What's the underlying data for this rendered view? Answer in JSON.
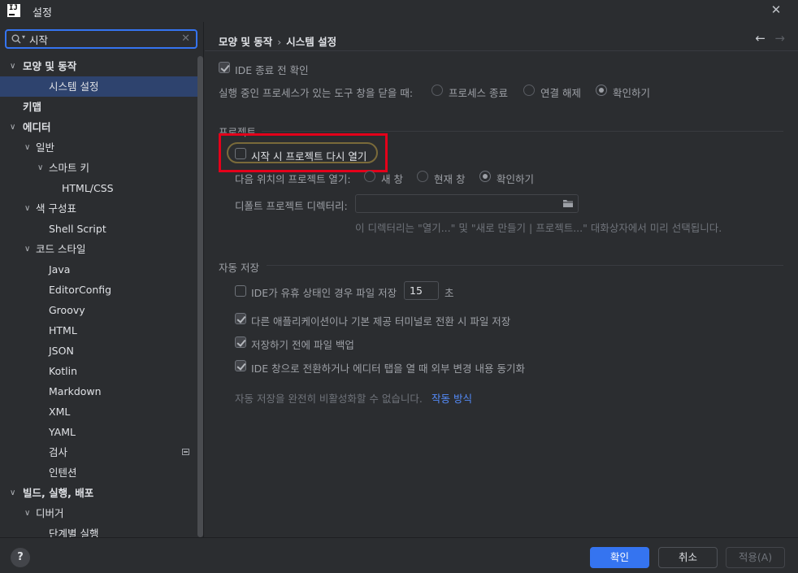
{
  "window": {
    "title": "설정",
    "logo_text": "IJ"
  },
  "search": {
    "value": "시작"
  },
  "tree": [
    {
      "label": "모양 및 동작",
      "arrow": "∨",
      "bold": true,
      "indent": 0
    },
    {
      "label": "시스템 설정",
      "arrow": "",
      "bold": false,
      "indent": 2,
      "selected": true
    },
    {
      "label": "키맵",
      "arrow": "",
      "bold": true,
      "indent": 0
    },
    {
      "label": "에디터",
      "arrow": "∨",
      "bold": true,
      "indent": 0
    },
    {
      "label": "일반",
      "arrow": "∨",
      "bold": false,
      "indent": 1
    },
    {
      "label": "스마트 키",
      "arrow": "∨",
      "bold": false,
      "indent": 2
    },
    {
      "label": "HTML/CSS",
      "arrow": "",
      "bold": false,
      "indent": 4
    },
    {
      "label": "색 구성표",
      "arrow": "∨",
      "bold": false,
      "indent": 1
    },
    {
      "label": "Shell Script",
      "arrow": "",
      "bold": false,
      "indent": 3
    },
    {
      "label": "코드 스타일",
      "arrow": "∨",
      "bold": false,
      "indent": 1
    },
    {
      "label": "Java",
      "arrow": "",
      "bold": false,
      "indent": 3
    },
    {
      "label": "EditorConfig",
      "arrow": "",
      "bold": false,
      "indent": 3
    },
    {
      "label": "Groovy",
      "arrow": "",
      "bold": false,
      "indent": 3
    },
    {
      "label": "HTML",
      "arrow": "",
      "bold": false,
      "indent": 3
    },
    {
      "label": "JSON",
      "arrow": "",
      "bold": false,
      "indent": 3
    },
    {
      "label": "Kotlin",
      "arrow": "",
      "bold": false,
      "indent": 3
    },
    {
      "label": "Markdown",
      "arrow": "",
      "bold": false,
      "indent": 3
    },
    {
      "label": "XML",
      "arrow": "",
      "bold": false,
      "indent": 3
    },
    {
      "label": "YAML",
      "arrow": "",
      "bold": false,
      "indent": 3
    },
    {
      "label": "검사",
      "arrow": "",
      "bold": false,
      "indent": 2,
      "badge": true
    },
    {
      "label": "인텐션",
      "arrow": "",
      "bold": false,
      "indent": 2
    },
    {
      "label": "빌드, 실행, 배포",
      "arrow": "∨",
      "bold": true,
      "indent": 0
    },
    {
      "label": "디버거",
      "arrow": "∨",
      "bold": false,
      "indent": 1
    },
    {
      "label": "단계별 실행",
      "arrow": "",
      "bold": false,
      "indent": 3
    }
  ],
  "breadcrumb": {
    "parent": "모양 및 동작",
    "separator": "›",
    "current": "시스템 설정"
  },
  "nav": {
    "back": "←",
    "forward": "→"
  },
  "settings": {
    "confirm_exit": {
      "label": "IDE 종료 전 확인",
      "checked": true
    },
    "close_tool_window": {
      "label": "실행 중인 프로세스가 있는 도구 창을 닫을 때:",
      "options": [
        "프로세스 종료",
        "연결 해제",
        "확인하기"
      ],
      "selected": "확인하기"
    },
    "project_section": "프로젝트",
    "reopen_projects": {
      "label": "시작 시 프로젝트 다시 열기",
      "checked": false
    },
    "open_new_project": {
      "label": "다음 위치의 프로젝트 열기:",
      "options": [
        "새 창",
        "현재 창",
        "확인하기"
      ],
      "selected": "확인하기"
    },
    "default_dir": {
      "label": "디폴트 프로젝트 디렉터리:",
      "value": ""
    },
    "default_dir_hint": "이 디렉터리는 \"열기...\" 및 \"새로 만들기 | 프로젝트...\" 대화상자에서 미리 선택됩니다.",
    "autosave_section": "자동 저장",
    "idle_save": {
      "label": "IDE가 유휴 상태인 경우 파일 저장",
      "checked": false,
      "value": "15",
      "unit": "초"
    },
    "frame_deactivate_save": {
      "label": "다른 애플리케이션이나 기본 제공 터미널로 전환 시 파일 저장",
      "checked": true
    },
    "backup_before_save": {
      "label": "저장하기 전에 파일 백업",
      "checked": true
    },
    "sync_external": {
      "label": "IDE 창으로 전환하거나 에디터 탭을 열 때 외부 변경 내용 동기화",
      "checked": true
    },
    "autosave_note": "자동 저장을 완전히 비활성화할 수 없습니다.",
    "autosave_link": "작동 방식"
  },
  "footer": {
    "help": "?",
    "ok": "확인",
    "cancel": "취소",
    "apply": "적용(A)"
  },
  "colors": {
    "accent": "#3574f0",
    "selection": "#2e436e",
    "highlight": "#e4001a",
    "link": "#548af7"
  }
}
